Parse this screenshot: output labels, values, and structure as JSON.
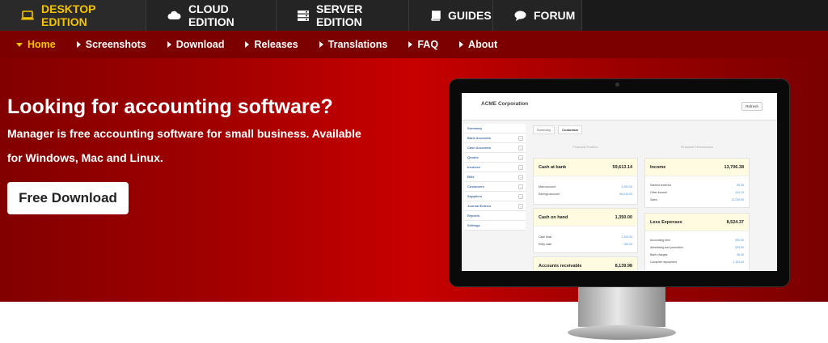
{
  "editions": [
    {
      "label": "DESKTOP EDITION",
      "icon": "laptop-icon",
      "active": true
    },
    {
      "label": "CLOUD EDITION",
      "icon": "cloud-icon",
      "active": false
    },
    {
      "label": "SERVER EDITION",
      "icon": "server-icon",
      "active": false
    },
    {
      "label": "GUIDES",
      "icon": "book-icon",
      "active": false
    },
    {
      "label": "FORUM",
      "icon": "chat-bubble-icon",
      "active": false
    }
  ],
  "nav": [
    {
      "label": "Home",
      "active": true
    },
    {
      "label": "Screenshots"
    },
    {
      "label": "Download"
    },
    {
      "label": "Releases"
    },
    {
      "label": "Translations"
    },
    {
      "label": "FAQ"
    },
    {
      "label": "About"
    }
  ],
  "hero": {
    "headline": "Looking for accounting software?",
    "subtext": "Manager is free accounting software for small business. Available for Windows, Mac and Linux.",
    "download_button": "Free Download"
  },
  "colors": {
    "accent": "#f5c400",
    "topbar": "#1a1a1a",
    "subnav": "#7d0000",
    "hero": "#c80000"
  },
  "screen": {
    "company": "ACME Corporation",
    "refresh": "Refresh",
    "tabs": [
      "Summary",
      "Customize"
    ],
    "sidebar": [
      "Summary",
      "Bank Accounts",
      "Cash Accounts",
      "Quotes",
      "Invoices",
      "Bills",
      "Customers",
      "Suppliers",
      "Journal Entries",
      "Reports",
      "Settings"
    ],
    "col_left": "Financial Position",
    "col_right": "Financial Performance",
    "cards": {
      "cash_at_bank": {
        "title": "Cash at bank",
        "total": "59,613.14",
        "rows": [
          [
            "Main account",
            "3,200.00"
          ],
          [
            "Savings account",
            "56,413.00"
          ]
        ]
      },
      "cash_on_hand": {
        "title": "Cash on hand",
        "total": "1,350.00",
        "rows": [
          [
            "Cash float",
            "1,200.00"
          ],
          [
            "Petty cash",
            "150.00"
          ]
        ]
      },
      "accounts_receivable": {
        "title": "Accounts receivable",
        "total": "8,139.98"
      },
      "income": {
        "title": "Income",
        "total": "13,706.38",
        "rows": [
          [
            "Interest received",
            "55.35"
          ],
          [
            "Other income",
            "414.13"
          ],
          [
            "Sales",
            "13,236.90"
          ]
        ]
      },
      "less_expenses": {
        "title": "Less Expenses",
        "total": "8,524.37",
        "rows": [
          [
            "Accounting fees",
            "900.00"
          ],
          [
            "Advertising and promotion",
            "323.00"
          ],
          [
            "Bank charges",
            "46.30"
          ],
          [
            "Computer equipment",
            "1,333.43"
          ]
        ]
      }
    }
  }
}
